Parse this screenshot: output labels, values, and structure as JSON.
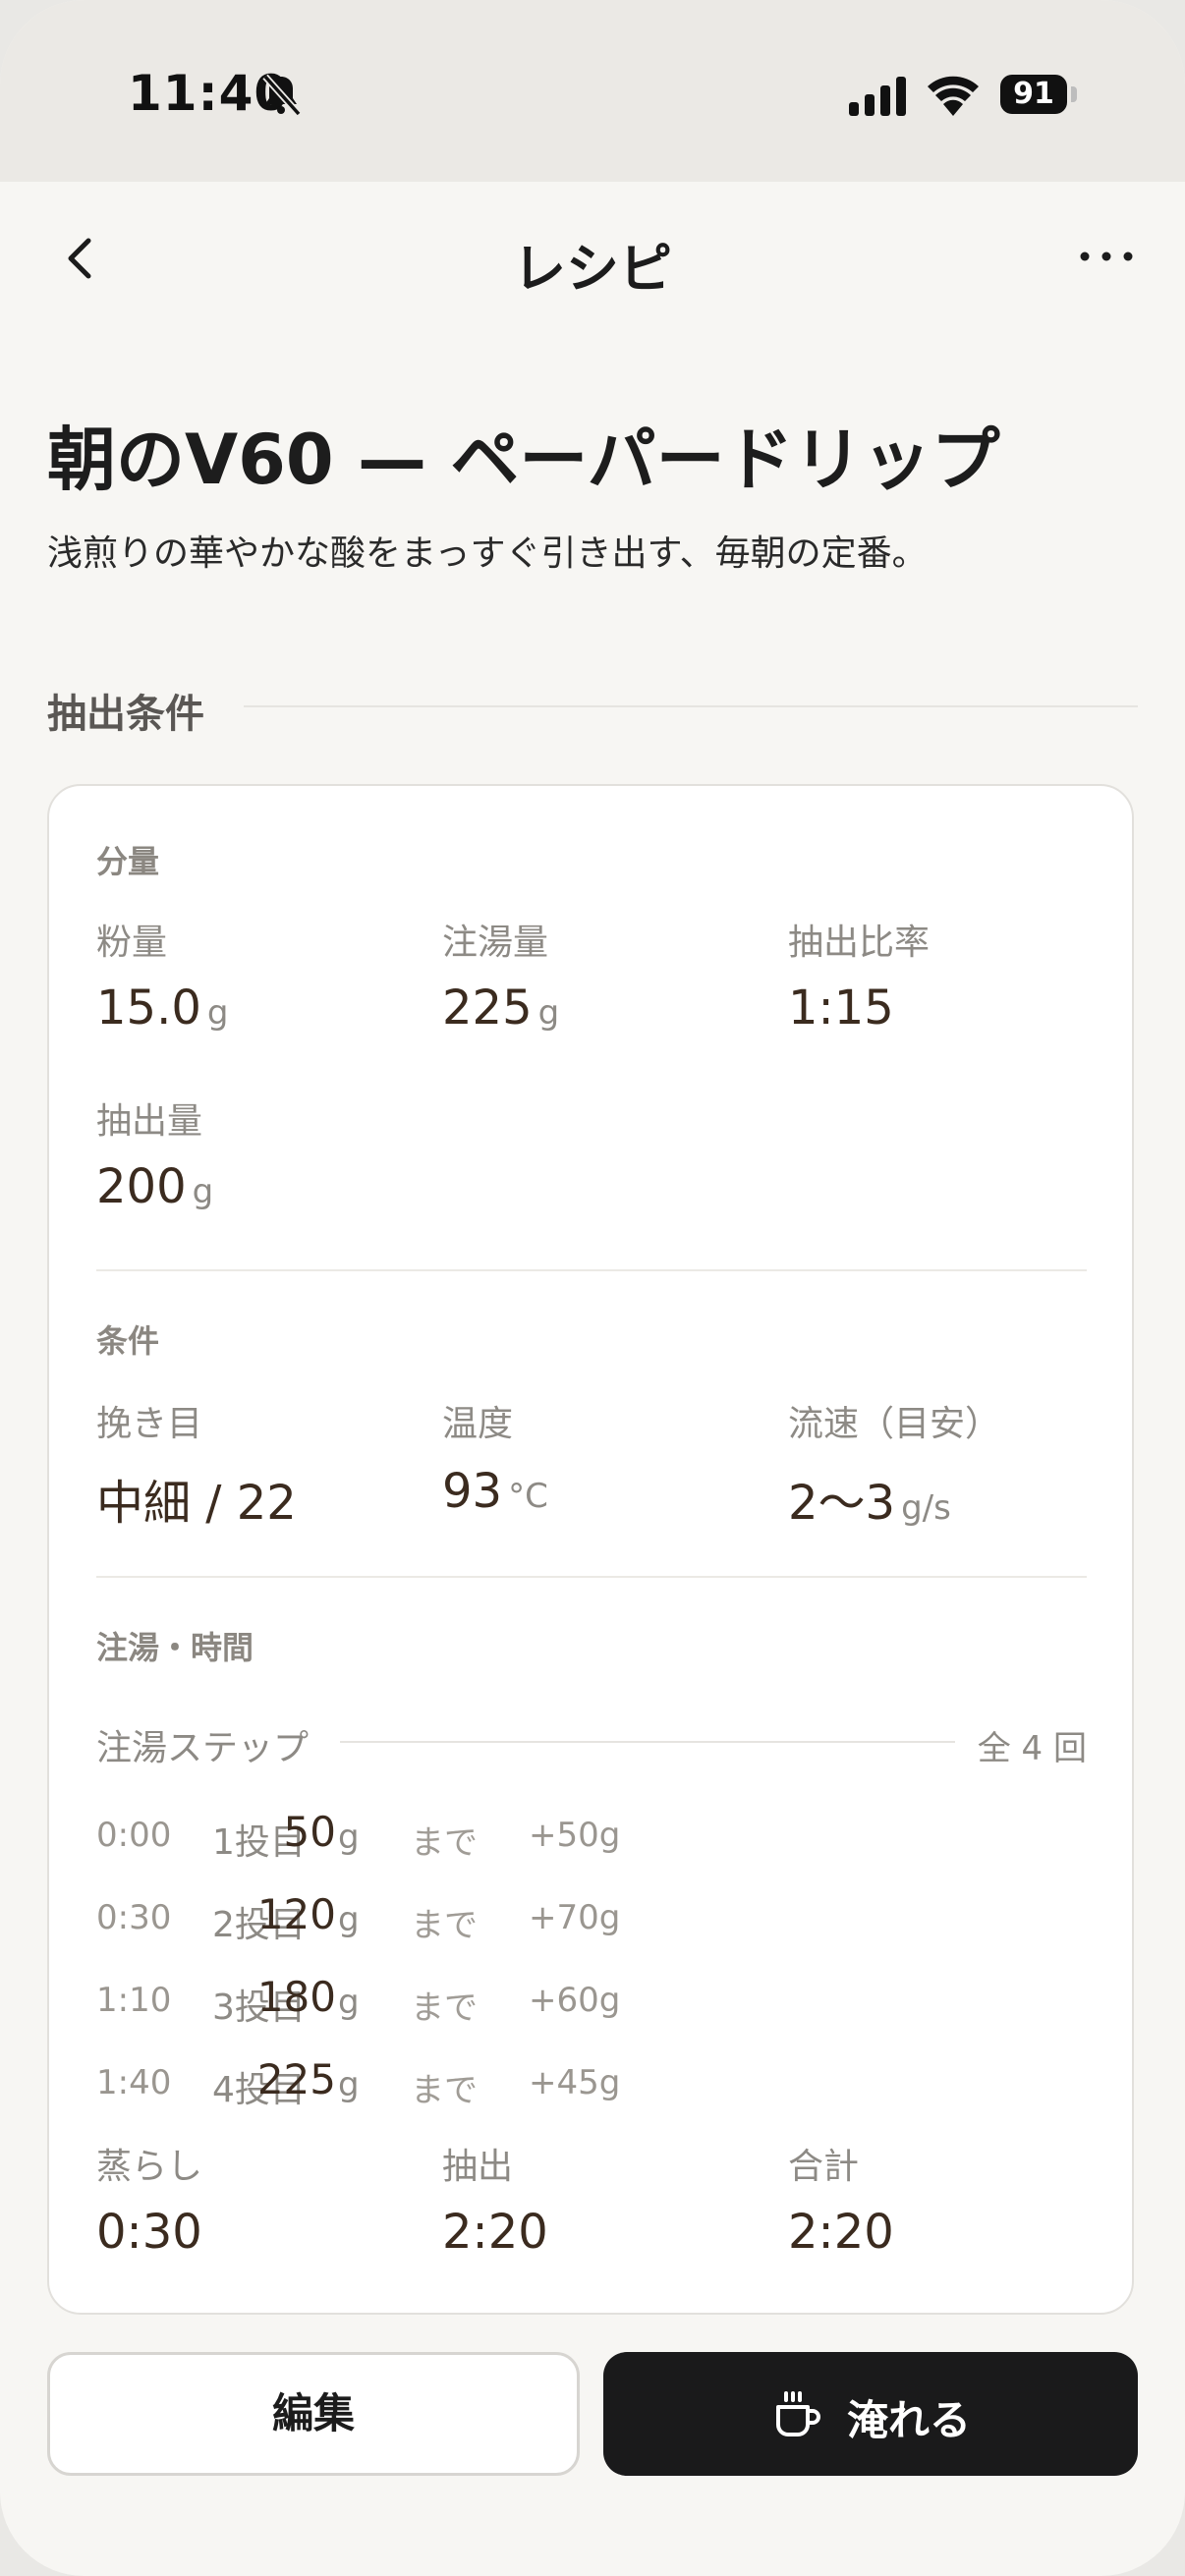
{
  "status_bar": {
    "time": "11:40",
    "battery": "91"
  },
  "nav": {
    "title": "レシピ"
  },
  "recipe": {
    "title": "朝のV60 — ペーパードリップ",
    "description": "浅煎りの華やかな酸をまっすぐ引き出す、毎朝の定番。"
  },
  "section": {
    "title": "抽出条件"
  },
  "amount": {
    "title": "分量",
    "dose": {
      "label": "粉量",
      "value": "15.0",
      "unit": "g"
    },
    "water": {
      "label": "注湯量",
      "value": "225",
      "unit": "g"
    },
    "ratio": {
      "label": "抽出比率",
      "value": "1:15"
    },
    "yield": {
      "label": "抽出量",
      "value": "200",
      "unit": "g"
    }
  },
  "conditions": {
    "title": "条件",
    "grind": {
      "label": "挽き目",
      "value": "中細 / 22"
    },
    "temp": {
      "label": "温度",
      "value": "93",
      "unit": "°C"
    },
    "flow": {
      "label": "流速（目安）",
      "value": "2〜3",
      "unit": "g/s"
    }
  },
  "timing": {
    "title": "注湯・時間",
    "steps_label": "注湯ステップ",
    "steps_count": "全 4 回",
    "steps": [
      {
        "time": "0:00",
        "name": "1投目",
        "amount": "50",
        "unit": "g",
        "until": "まで",
        "delta": "+50g"
      },
      {
        "time": "0:30",
        "name": "2投目",
        "amount": "120",
        "unit": "g",
        "until": "まで",
        "delta": "+70g"
      },
      {
        "time": "1:10",
        "name": "3投目",
        "amount": "180",
        "unit": "g",
        "until": "まで",
        "delta": "+60g"
      },
      {
        "time": "1:40",
        "name": "4投目",
        "amount": "225",
        "unit": "g",
        "until": "まで",
        "delta": "+45g"
      }
    ],
    "bloom": {
      "label": "蒸らし",
      "value": "0:30"
    },
    "extraction": {
      "label": "抽出",
      "value": "2:20"
    },
    "total": {
      "label": "合計",
      "value": "2:20"
    }
  },
  "actions": {
    "edit": "編集",
    "brew": "淹れる"
  }
}
